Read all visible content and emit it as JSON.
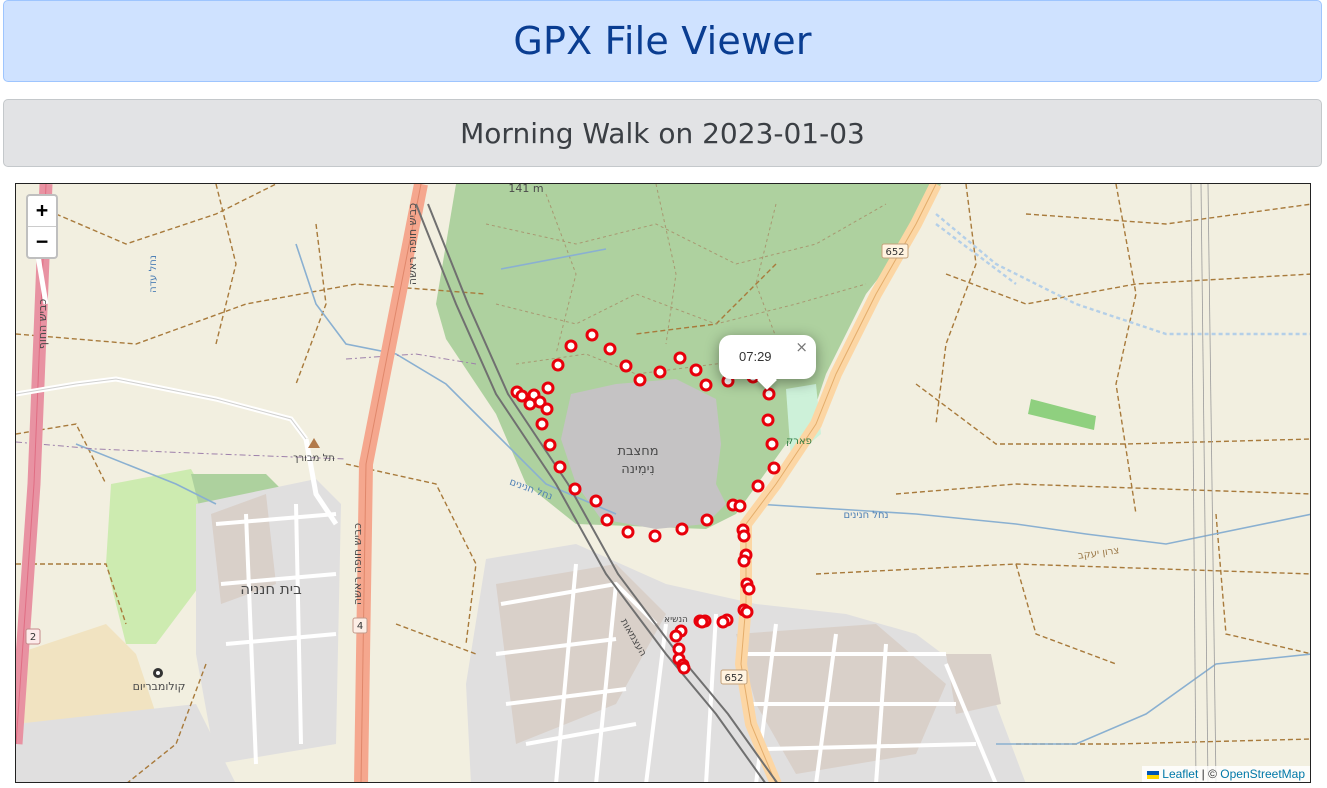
{
  "header": {
    "title": "GPX File Viewer"
  },
  "track": {
    "title": "Morning Walk on 2023-01-03"
  },
  "map": {
    "zoom_in": "+",
    "zoom_out": "−",
    "popup": {
      "time": "07:29",
      "close": "×"
    },
    "attribution": {
      "leaflet": "Leaflet",
      "separator": "| ©",
      "osm": "OpenStreetMap"
    },
    "route_markers": {
      "fill": "#ffffff",
      "stroke": "#e8000b"
    },
    "labels": {
      "quarry": "מחצבת",
      "quarry2": "נִימִינה",
      "beit_hanania": "בית חנניה",
      "kolumbarium": "קולומבריום",
      "tel_mevorah": "תל מבורך",
      "nahal_hanina": "נחל חנינים",
      "nahal_hanina2": "נחל חנינים",
      "park": "פארק",
      "road652": "652",
      "road652b": "652",
      "road2": "2",
      "road4": "4",
      "elevation": "141 m",
      "tzvon": "צרון יעקב",
      "nahal_ada": "נחל עדה",
      "road4_name": "כביש חופה ראשה",
      "road4_name2": "כביש חופה ראשה",
      "road2_name": "כביש החוף",
      "ha_atzmaut": "העצמאות",
      "hanassi": "הנשיא"
    }
  }
}
